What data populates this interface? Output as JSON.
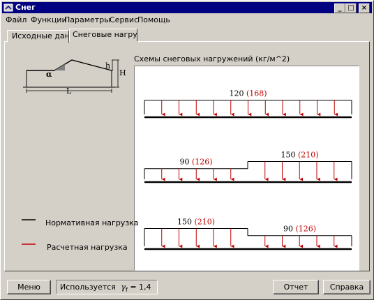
{
  "window": {
    "title": "Снег",
    "minimize": "_",
    "maximize": "□",
    "close": "×"
  },
  "menu": [
    "Файл",
    "Функции",
    "Параметры",
    "Сервис",
    "Помощь"
  ],
  "tabs": [
    {
      "label": "Исходные данные",
      "active": false
    },
    {
      "label": "Снеговые нагрузки",
      "active": true
    }
  ],
  "diagram": {
    "alpha": "α",
    "h": "h",
    "H": "H",
    "L": "L"
  },
  "schemes_title": "Схемы снеговых нагружений (кг/м^2)",
  "schemes": [
    {
      "segments": [
        {
          "normative": "120",
          "design": "(168)"
        }
      ]
    },
    {
      "segments": [
        {
          "normative": "90",
          "design": "(126)"
        },
        {
          "normative": "150",
          "design": "(210)"
        }
      ]
    },
    {
      "segments": [
        {
          "normative": "150",
          "design": "(210)"
        },
        {
          "normative": "90",
          "design": "(126)"
        }
      ]
    }
  ],
  "legend": {
    "normative": {
      "label": "Нормативная нагрузка",
      "color": "#000000"
    },
    "design": {
      "label": "Расчетная нагрузка",
      "color": "#c00000"
    }
  },
  "buttons": {
    "menu": "Меню",
    "report": "Отчет",
    "help": "Справка"
  },
  "status": {
    "prefix": "Используется",
    "symbol": "γ",
    "subscript": "f",
    "value": "= 1,4"
  }
}
